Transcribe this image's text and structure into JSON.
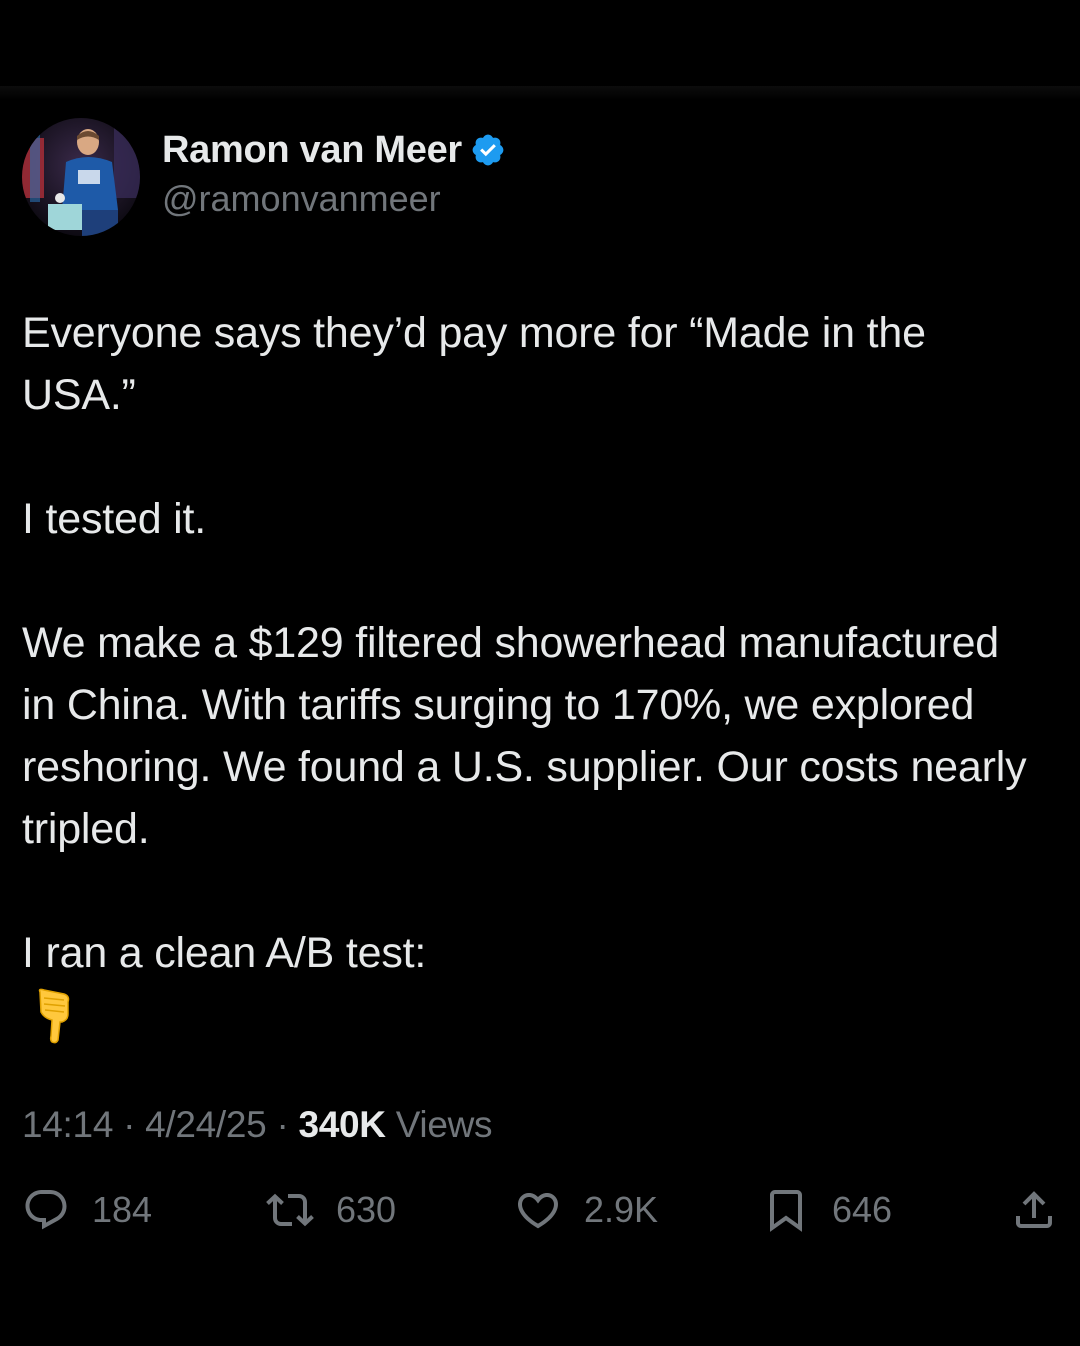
{
  "author": {
    "display_name": "Ramon van Meer",
    "handle": "@ramonvanmeer",
    "verified": true,
    "verified_color": "#1d9bf0"
  },
  "tweet": {
    "paragraphs": [
      "Everyone says they’d pay more for “Made in the USA.”",
      "I tested it.",
      "We make a $129 filtered showerhead manufactured in China. With tariffs surging to 170%, we explored reshoring. We found a U.S. supplier. Our costs nearly tripled.",
      "I ran a clean A/B test:"
    ],
    "emoji": "backhand-index-pointing-down"
  },
  "meta": {
    "time": "14:14",
    "separator": "·",
    "date": "4/24/25",
    "views_count": "340K",
    "views_label": "Views"
  },
  "actions": {
    "replies": "184",
    "reposts": "630",
    "likes": "2.9K",
    "bookmarks": "646"
  },
  "colors": {
    "background": "#000000",
    "text_primary": "#e7e9ea",
    "text_secondary": "#71767b"
  }
}
